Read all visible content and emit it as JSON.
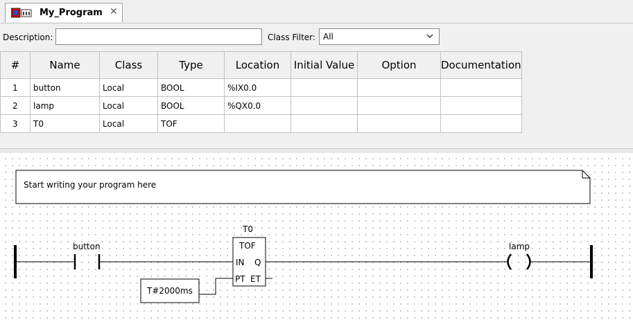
{
  "tab": {
    "title": "My_Program",
    "icon": "program-icon",
    "close_icon": "close-icon"
  },
  "filters": {
    "description_label": "Description:",
    "description_value": "",
    "class_filter_label": "Class Filter:",
    "class_filter_value": "All"
  },
  "variables": {
    "columns": [
      "#",
      "Name",
      "Class",
      "Type",
      "Location",
      "Initial Value",
      "Option",
      "Documentation"
    ],
    "rows": [
      {
        "num": "1",
        "name": "button",
        "class": "Local",
        "type": "BOOL",
        "location": "%IX0.0",
        "initial": "",
        "option": "",
        "doc": ""
      },
      {
        "num": "2",
        "name": "lamp",
        "class": "Local",
        "type": "BOOL",
        "location": "%QX0.0",
        "initial": "",
        "option": "",
        "doc": ""
      },
      {
        "num": "3",
        "name": "T0",
        "class": "Local",
        "type": "TOF",
        "location": "",
        "initial": "",
        "option": "",
        "doc": ""
      }
    ]
  },
  "diagram": {
    "comment": "Start writing your program here",
    "contact_label": "button",
    "block_instance": "T0",
    "block_type": "TOF",
    "pin_in": "IN",
    "pin_q": "Q",
    "pin_pt": "PT",
    "pin_et": "ET",
    "constant": "T#2000ms",
    "coil_label": "lamp",
    "coil_symbol": "( )"
  }
}
